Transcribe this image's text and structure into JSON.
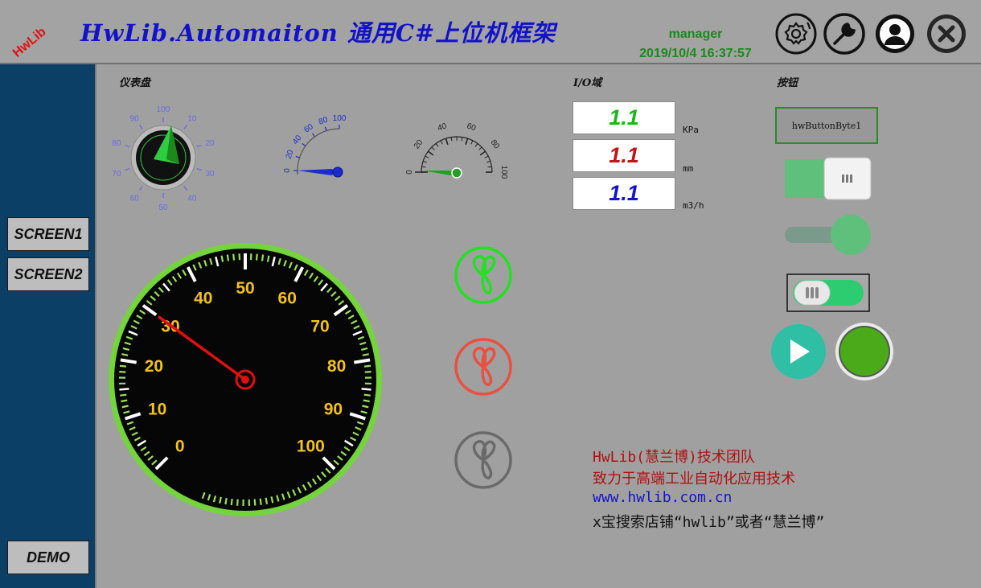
{
  "header": {
    "logo_text": "HwLib",
    "title": "HwLib.Automaiton 通用C#上位机框架",
    "user": "manager",
    "datetime": "2019/10/4 16:37:57",
    "buttons": [
      "settings-icon",
      "wrench-icon",
      "user-icon",
      "close-icon"
    ]
  },
  "sidebar": {
    "items": [
      {
        "label": "SCREEN1"
      },
      {
        "label": "SCREEN2"
      },
      {
        "label": "DEMO"
      }
    ]
  },
  "sections": {
    "gauges_label": "仪表盘",
    "io_label": "I/O域",
    "buttons_label": "按钮"
  },
  "dial_gauge": {
    "ticks": [
      "100",
      "10",
      "20",
      "30",
      "40",
      "50",
      "60",
      "70",
      "80",
      "90"
    ]
  },
  "arc_gauge_blue": {
    "ticks": [
      "0",
      "20",
      "40",
      "60",
      "80",
      "100"
    ]
  },
  "arc_gauge_green": {
    "ticks": [
      "0",
      "20",
      "40",
      "60",
      "80",
      "100"
    ]
  },
  "speedometer": {
    "ticks": [
      "0",
      "10",
      "20",
      "30",
      "40",
      "50",
      "60",
      "70",
      "80",
      "90",
      "100"
    ],
    "value": 30
  },
  "io": [
    {
      "value": "1.1",
      "unit": "KPa",
      "color": "#1cb61c"
    },
    {
      "value": "1.1",
      "unit": "mm",
      "color": "#c01616"
    },
    {
      "value": "1.1",
      "unit": "m3/h",
      "color": "#1414d0"
    }
  ],
  "fans": [
    {
      "state": "running",
      "color": "#22e022"
    },
    {
      "state": "fault",
      "color": "#e85040"
    },
    {
      "state": "off",
      "color": "#707070"
    }
  ],
  "controls": {
    "byte_button_label": "hwButtonByte1",
    "toggle1_on": true,
    "toggle2_on": true,
    "toggle3_on": true,
    "play_color": "#2fbfa4",
    "lamp_color": "#4aaa1a"
  },
  "info": {
    "line1": "HwLib(慧兰博)技术团队",
    "line2": "致力于高端工业自动化应用技术",
    "line3": "www.hwlib.com.cn",
    "line4": "x宝搜索店铺“hwlib”或者“慧兰博”",
    "colors": {
      "red": "#b01010",
      "blue": "#1414c8",
      "black": "#111111"
    }
  }
}
